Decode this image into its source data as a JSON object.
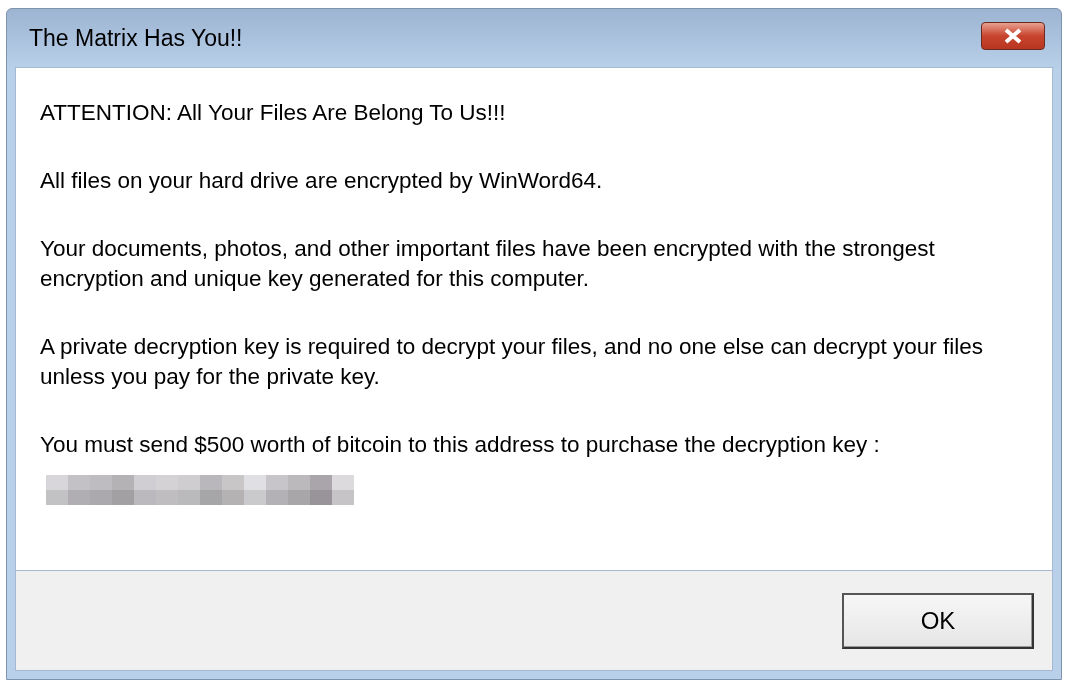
{
  "window": {
    "title": "The Matrix Has You!!"
  },
  "message": {
    "paragraphs": [
      "ATTENTION: All Your Files Are Belong To Us!!!",
      "All files on your hard drive are encrypted by WinWord64.",
      "Your documents, photos, and other important files have been encrypted with the strongest encryption and unique key generated for this computer.",
      "A private decryption key is required to decrypt your files, and no one else can decrypt your files unless you pay for the private key.",
      "You must send $500 worth of bitcoin to this address to purchase the decryption key :"
    ],
    "redacted_address": true
  },
  "buttons": [
    "OK"
  ]
}
